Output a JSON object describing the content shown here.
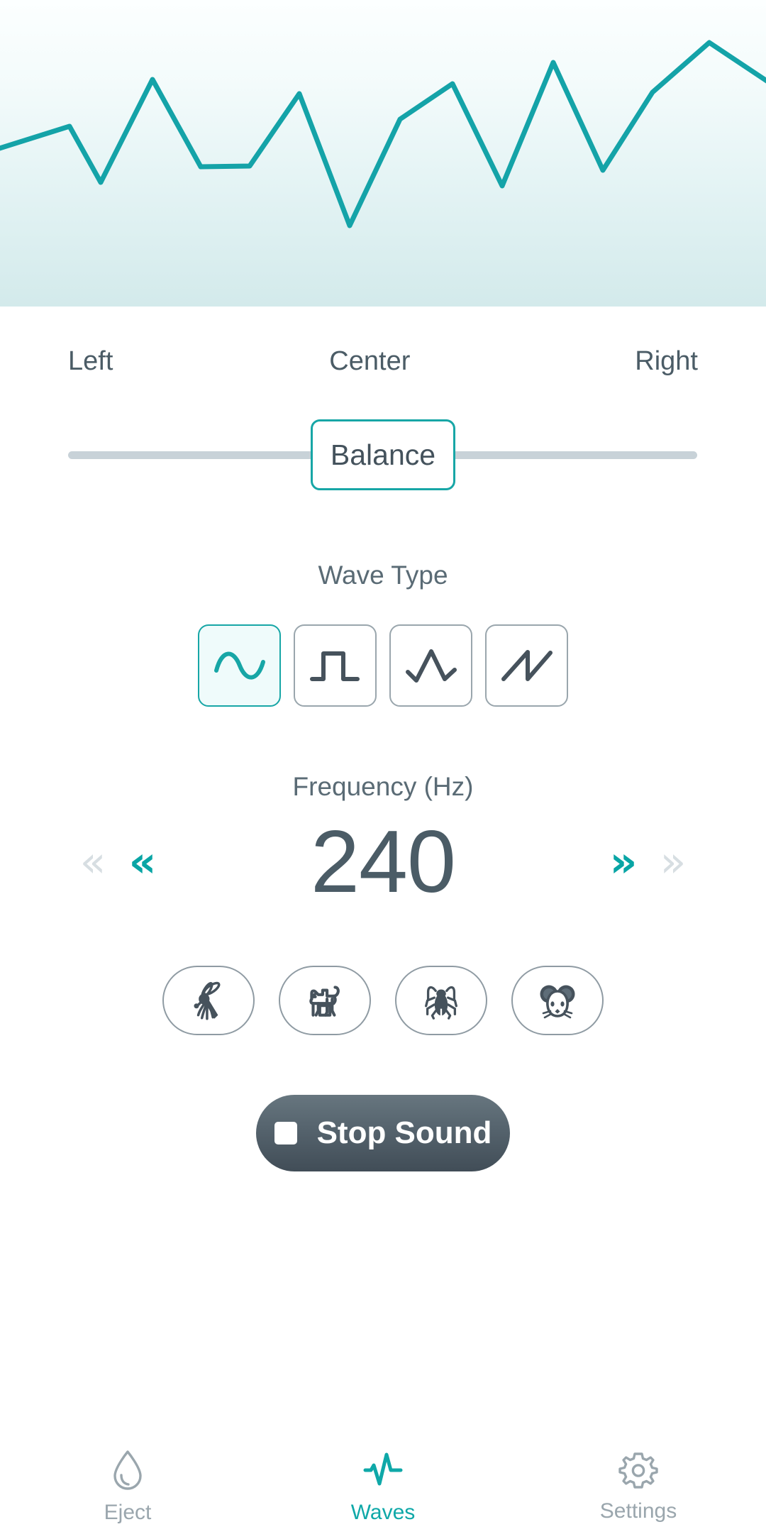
{
  "hero": {
    "name": "waveform-preview",
    "line_color": "#14a3a8",
    "gradient_top": "#fcffff",
    "gradient_bottom": "#d3eaeb"
  },
  "balance": {
    "left_label": "Left",
    "center_label": "Center",
    "right_label": "Right",
    "thumb_label": "Balance",
    "value_percent": 50,
    "track_color": "#c8d2d8",
    "accent": "#17a6a6"
  },
  "wave_type": {
    "title": "Wave Type",
    "selected_index": 0,
    "options": [
      {
        "label": "Sine",
        "icon": "sine-wave-icon",
        "selected": true
      },
      {
        "label": "Square",
        "icon": "square-wave-icon",
        "selected": false
      },
      {
        "label": "Triangle",
        "icon": "triangle-wave-icon",
        "selected": false
      },
      {
        "label": "Sawtooth",
        "icon": "sawtooth-wave-icon",
        "selected": false
      }
    ]
  },
  "frequency": {
    "title": "Frequency (Hz)",
    "value": "240",
    "controls": [
      {
        "name": "decrease-coarse",
        "icon": "chevron-double-left-icon",
        "state": "disabled"
      },
      {
        "name": "decrease-fine",
        "icon": "chevron-double-left-icon",
        "state": "enabled"
      },
      {
        "name": "increase-fine",
        "icon": "chevron-double-right-icon",
        "state": "enabled"
      },
      {
        "name": "increase-coarse",
        "icon": "chevron-double-right-icon",
        "state": "disabled"
      }
    ]
  },
  "presets": [
    {
      "label": "Mosquito",
      "icon": "mosquito-icon"
    },
    {
      "label": "Dog",
      "icon": "dog-icon"
    },
    {
      "label": "Cockroach",
      "icon": "cockroach-icon"
    },
    {
      "label": "Mouse",
      "icon": "mouse-icon"
    }
  ],
  "transport": {
    "label": "Stop Sound",
    "icon": "stop-square-icon",
    "state": "playing"
  },
  "tabbar": {
    "active_index": 1,
    "active_color": "#0fa8a8",
    "inactive_color": "#9aa6ad",
    "tabs": [
      {
        "label": "Eject",
        "icon": "water-drop-icon",
        "active": false
      },
      {
        "label": "Waves",
        "icon": "pulse-wave-icon",
        "active": true
      },
      {
        "label": "Settings",
        "icon": "gear-icon",
        "active": false
      }
    ]
  },
  "chart_data": {
    "type": "line",
    "title": "",
    "xlabel": "",
    "ylabel": "",
    "grid": false,
    "legend": "none",
    "line_color": "#14a3a8",
    "x": [
      0,
      1,
      2,
      3,
      4,
      5,
      6,
      7,
      8,
      9,
      10,
      11,
      12,
      13,
      14
    ],
    "y": [
      0.42,
      0.64,
      0.22,
      0.86,
      0.5,
      0.44,
      0.44,
      0.78,
      0.1,
      0.56,
      0.72,
      0.84,
      0.26,
      0.8,
      0.92
    ]
  }
}
